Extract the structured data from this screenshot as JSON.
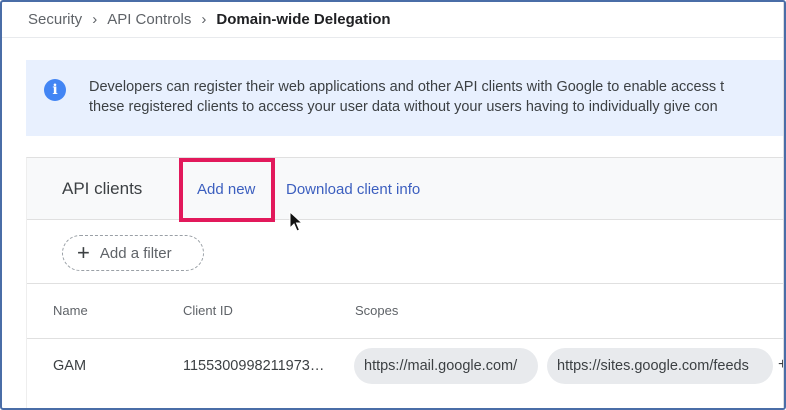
{
  "breadcrumb": {
    "items": [
      "Security",
      "API Controls"
    ],
    "current": "Domain-wide Delegation"
  },
  "info_banner": {
    "icon": "info-icon",
    "line1": "Developers can register their web applications and other API clients with Google to enable access t",
    "line2": "these registered clients to access your user data without your users having to individually give con"
  },
  "api_clients": {
    "title": "API clients",
    "add_new_label": "Add new",
    "download_label": "Download client info",
    "highlight_color": "#e2195b",
    "filter_label": "Add a filter",
    "columns": [
      "Name",
      "Client ID",
      "Scopes"
    ],
    "rows": [
      {
        "name": "GAM",
        "client_id": "1155300998211973…",
        "scopes": [
          "https://mail.google.com/",
          "https://sites.google.com/feeds"
        ],
        "more": "+"
      }
    ]
  },
  "colors": {
    "link": "#3c5fbf",
    "banner_bg": "#e8f0fe",
    "info_icon": "#4285f4",
    "frame_border": "#4a6da7"
  }
}
